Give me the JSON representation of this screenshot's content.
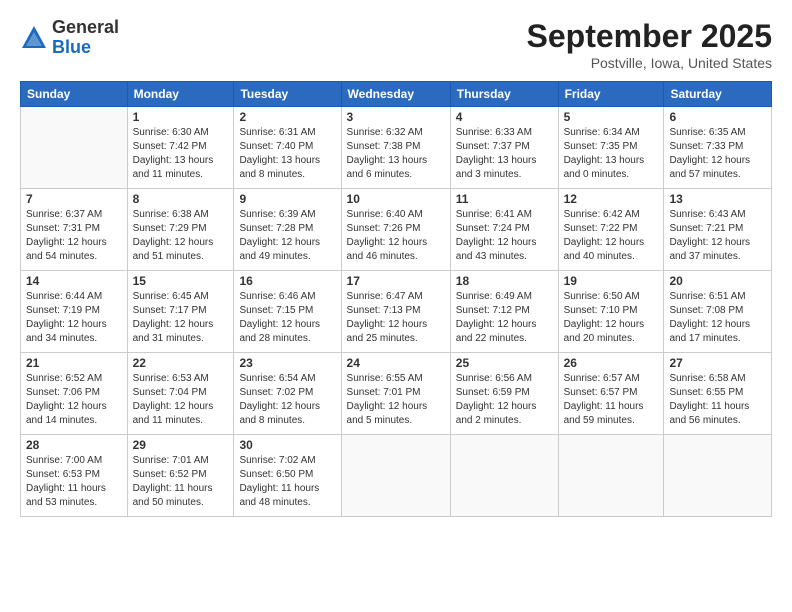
{
  "logo": {
    "general": "General",
    "blue": "Blue"
  },
  "title": "September 2025",
  "location": "Postville, Iowa, United States",
  "days_of_week": [
    "Sunday",
    "Monday",
    "Tuesday",
    "Wednesday",
    "Thursday",
    "Friday",
    "Saturday"
  ],
  "weeks": [
    [
      {
        "day": "",
        "detail": ""
      },
      {
        "day": "1",
        "detail": "Sunrise: 6:30 AM\nSunset: 7:42 PM\nDaylight: 13 hours\nand 11 minutes."
      },
      {
        "day": "2",
        "detail": "Sunrise: 6:31 AM\nSunset: 7:40 PM\nDaylight: 13 hours\nand 8 minutes."
      },
      {
        "day": "3",
        "detail": "Sunrise: 6:32 AM\nSunset: 7:38 PM\nDaylight: 13 hours\nand 6 minutes."
      },
      {
        "day": "4",
        "detail": "Sunrise: 6:33 AM\nSunset: 7:37 PM\nDaylight: 13 hours\nand 3 minutes."
      },
      {
        "day": "5",
        "detail": "Sunrise: 6:34 AM\nSunset: 7:35 PM\nDaylight: 13 hours\nand 0 minutes."
      },
      {
        "day": "6",
        "detail": "Sunrise: 6:35 AM\nSunset: 7:33 PM\nDaylight: 12 hours\nand 57 minutes."
      }
    ],
    [
      {
        "day": "7",
        "detail": "Sunrise: 6:37 AM\nSunset: 7:31 PM\nDaylight: 12 hours\nand 54 minutes."
      },
      {
        "day": "8",
        "detail": "Sunrise: 6:38 AM\nSunset: 7:29 PM\nDaylight: 12 hours\nand 51 minutes."
      },
      {
        "day": "9",
        "detail": "Sunrise: 6:39 AM\nSunset: 7:28 PM\nDaylight: 12 hours\nand 49 minutes."
      },
      {
        "day": "10",
        "detail": "Sunrise: 6:40 AM\nSunset: 7:26 PM\nDaylight: 12 hours\nand 46 minutes."
      },
      {
        "day": "11",
        "detail": "Sunrise: 6:41 AM\nSunset: 7:24 PM\nDaylight: 12 hours\nand 43 minutes."
      },
      {
        "day": "12",
        "detail": "Sunrise: 6:42 AM\nSunset: 7:22 PM\nDaylight: 12 hours\nand 40 minutes."
      },
      {
        "day": "13",
        "detail": "Sunrise: 6:43 AM\nSunset: 7:21 PM\nDaylight: 12 hours\nand 37 minutes."
      }
    ],
    [
      {
        "day": "14",
        "detail": "Sunrise: 6:44 AM\nSunset: 7:19 PM\nDaylight: 12 hours\nand 34 minutes."
      },
      {
        "day": "15",
        "detail": "Sunrise: 6:45 AM\nSunset: 7:17 PM\nDaylight: 12 hours\nand 31 minutes."
      },
      {
        "day": "16",
        "detail": "Sunrise: 6:46 AM\nSunset: 7:15 PM\nDaylight: 12 hours\nand 28 minutes."
      },
      {
        "day": "17",
        "detail": "Sunrise: 6:47 AM\nSunset: 7:13 PM\nDaylight: 12 hours\nand 25 minutes."
      },
      {
        "day": "18",
        "detail": "Sunrise: 6:49 AM\nSunset: 7:12 PM\nDaylight: 12 hours\nand 22 minutes."
      },
      {
        "day": "19",
        "detail": "Sunrise: 6:50 AM\nSunset: 7:10 PM\nDaylight: 12 hours\nand 20 minutes."
      },
      {
        "day": "20",
        "detail": "Sunrise: 6:51 AM\nSunset: 7:08 PM\nDaylight: 12 hours\nand 17 minutes."
      }
    ],
    [
      {
        "day": "21",
        "detail": "Sunrise: 6:52 AM\nSunset: 7:06 PM\nDaylight: 12 hours\nand 14 minutes."
      },
      {
        "day": "22",
        "detail": "Sunrise: 6:53 AM\nSunset: 7:04 PM\nDaylight: 12 hours\nand 11 minutes."
      },
      {
        "day": "23",
        "detail": "Sunrise: 6:54 AM\nSunset: 7:02 PM\nDaylight: 12 hours\nand 8 minutes."
      },
      {
        "day": "24",
        "detail": "Sunrise: 6:55 AM\nSunset: 7:01 PM\nDaylight: 12 hours\nand 5 minutes."
      },
      {
        "day": "25",
        "detail": "Sunrise: 6:56 AM\nSunset: 6:59 PM\nDaylight: 12 hours\nand 2 minutes."
      },
      {
        "day": "26",
        "detail": "Sunrise: 6:57 AM\nSunset: 6:57 PM\nDaylight: 11 hours\nand 59 minutes."
      },
      {
        "day": "27",
        "detail": "Sunrise: 6:58 AM\nSunset: 6:55 PM\nDaylight: 11 hours\nand 56 minutes."
      }
    ],
    [
      {
        "day": "28",
        "detail": "Sunrise: 7:00 AM\nSunset: 6:53 PM\nDaylight: 11 hours\nand 53 minutes."
      },
      {
        "day": "29",
        "detail": "Sunrise: 7:01 AM\nSunset: 6:52 PM\nDaylight: 11 hours\nand 50 minutes."
      },
      {
        "day": "30",
        "detail": "Sunrise: 7:02 AM\nSunset: 6:50 PM\nDaylight: 11 hours\nand 48 minutes."
      },
      {
        "day": "",
        "detail": ""
      },
      {
        "day": "",
        "detail": ""
      },
      {
        "day": "",
        "detail": ""
      },
      {
        "day": "",
        "detail": ""
      }
    ]
  ]
}
